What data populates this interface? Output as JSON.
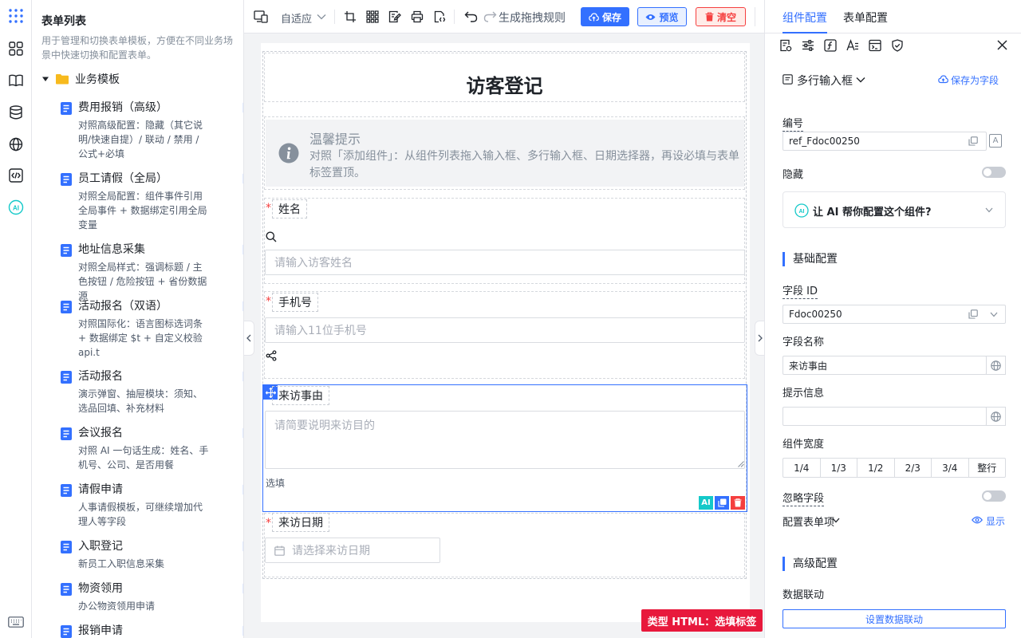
{
  "rail": {
    "icons": [
      "apps-icon",
      "grid-icon",
      "book-icon",
      "database-icon",
      "globe-icon",
      "code-icon",
      "ai-icon",
      "keyboard-icon"
    ],
    "ai_badge": "AI"
  },
  "template_list": {
    "title": "表单列表",
    "description": "用于管理和切换表单模板，方便在不同业务场景中快速切换和配置表单。",
    "group": "业务模板",
    "items": [
      {
        "name": "费用报销（高级）",
        "desc": "对照高级配置：隐藏（其它说明/快速自提）/ 联动 / 禁用 / 公式+必填"
      },
      {
        "name": "员工请假（全局）",
        "desc": "对照全局配置：组件事件引用全局事件 + 数据绑定引用全局变量"
      },
      {
        "name": "地址信息采集",
        "desc": "对照全局样式：强调标题 / 主色按钮 / 危险按钮 + 省份数据源"
      },
      {
        "name": "活动报名（双语）",
        "desc": "对照国际化：语言图标选词条 + 数据绑定 $t + 自定义校验 api.t"
      },
      {
        "name": "活动报名",
        "desc": "演示弹窗、抽屉模块：须知、选品回填、补充材料"
      },
      {
        "name": "会议报名",
        "desc": "对照 AI 一句话生成：姓名、手机号、公司、是否用餐"
      },
      {
        "name": "请假申请",
        "desc": "人事请假模板，可继续增加代理人等字段"
      },
      {
        "name": "入职登记",
        "desc": "新员工入职信息采集"
      },
      {
        "name": "物资领用",
        "desc": "办公物资领用申请"
      },
      {
        "name": "报销申请",
        "desc": ""
      }
    ]
  },
  "toolbar": {
    "view_mode": "自适应",
    "generate_rules": "生成拖拽规则",
    "save": "保存",
    "preview": "预览",
    "clear": "清空"
  },
  "form": {
    "title": "访客登记",
    "notice_title": "温馨提示",
    "notice_text": "对照「添加组件」：从组件列表拖入输入框、多行输入框、日期选择器，再设必填与表单标签置顶。",
    "required_mark": "*",
    "fields": {
      "name": {
        "label": "姓名",
        "placeholder": "请输入访客姓名"
      },
      "phone": {
        "label": "手机号",
        "placeholder": "请输入11位手机号"
      },
      "reason": {
        "label": "来访事由",
        "placeholder": "请简要说明来访目的",
        "hint": "选填"
      },
      "date": {
        "label": "来访日期",
        "placeholder": "请选择来访日期"
      }
    },
    "selected_tools": {
      "ai": "AI"
    }
  },
  "type_badge": "类型 HTML：选填标签",
  "right_panel": {
    "tabs": [
      "组件配置",
      "表单配置"
    ],
    "component_type": "多行输入框",
    "save_as_field": "保存为字段",
    "id_label": "编号",
    "id_value": "ref_Fdoc00250",
    "id_suffix": "A",
    "hidden_label": "隐藏",
    "ai_prompt": "让 AI 帮你配置这个组件?",
    "ai_badge": "AI",
    "basic_section": "基础配置",
    "field_id_label": "字段 ID",
    "field_id_value": "Fdoc00250",
    "field_name_label": "字段名称",
    "field_name_value": "来访事由",
    "hint_label": "提示信息",
    "hint_value": "",
    "width_label": "组件宽度",
    "width_options": [
      "1/4",
      "1/3",
      "1/2",
      "2/3",
      "3/4",
      "整行"
    ],
    "ignore_label": "忽略字段",
    "form_items_label": "配置表单项",
    "show_label": "显示",
    "advanced_section": "高级配置",
    "linkage_label": "数据联动",
    "linkage_button": "设置数据联动"
  },
  "colors": {
    "primary": "#3370ff",
    "danger": "#f53f3f",
    "badge": "#e8193c",
    "folder": "#f7ba1e"
  }
}
